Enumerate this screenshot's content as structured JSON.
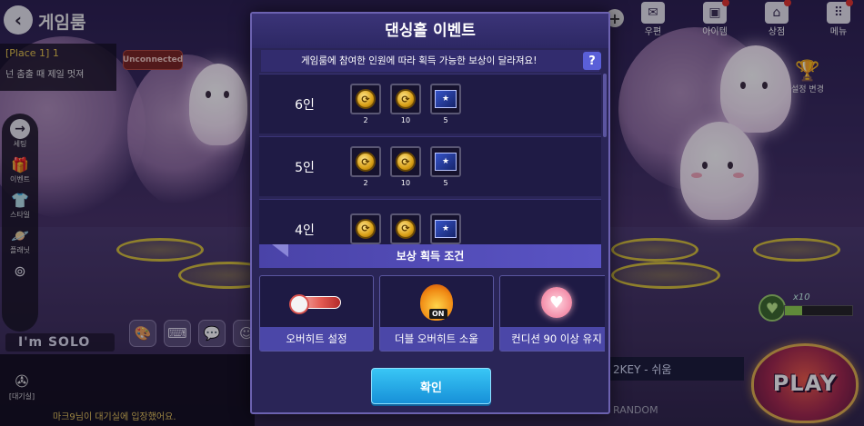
{
  "header": {
    "back_icon": "back-arrow-icon",
    "title": "게임룸",
    "top_icons": [
      {
        "name": "mail",
        "label": "우편",
        "glyph": "✉",
        "badge": false
      },
      {
        "name": "item",
        "label": "아이템",
        "glyph": "▣",
        "badge": true
      },
      {
        "name": "shop",
        "label": "상점",
        "glyph": "⌂",
        "badge": true
      },
      {
        "name": "menu",
        "label": "메뉴",
        "glyph": "⠿",
        "badge": true
      }
    ]
  },
  "place_box": {
    "place": "[Place 1] 1",
    "room_name": "넌 춤출 때 제일 멋져"
  },
  "status_badge": "Unconnected",
  "sidebar": {
    "items": [
      {
        "label": "세팅",
        "icon": "arrow-right-icon"
      },
      {
        "label": "이벤트",
        "icon": "gift-icon"
      },
      {
        "label": "스타일",
        "icon": "shirt-icon"
      },
      {
        "label": "플래닛",
        "icon": "planet-icon"
      },
      {
        "label": "",
        "icon": "binoculars-icon"
      }
    ]
  },
  "solo_tag": "I'm SOLO",
  "chat": {
    "wait_label": "[대기실]",
    "message": "마크9님이 대기실에 입장했어요."
  },
  "right_panel": {
    "settings_label": "설정 변경",
    "level_text": "x10",
    "xp_fraction": 0.25,
    "song_mode": "2KEY - 쉬움",
    "song_sub": "RANDOM",
    "play_label": "PLAY"
  },
  "modal": {
    "title": "댄싱홀 이벤트",
    "subtitle": "게임룸에 참여한 인원에 따라 획득 가능한 보상이 달라져요!",
    "help": "?",
    "rewards": [
      {
        "label": "6인",
        "items": [
          {
            "type": "coin",
            "qty": "2"
          },
          {
            "type": "coin",
            "qty": "10"
          },
          {
            "type": "ticket",
            "qty": "5"
          }
        ]
      },
      {
        "label": "5인",
        "items": [
          {
            "type": "coin",
            "qty": "2"
          },
          {
            "type": "coin",
            "qty": "10"
          },
          {
            "type": "ticket",
            "qty": "5"
          }
        ]
      },
      {
        "label": "4인",
        "items": [
          {
            "type": "coin",
            "qty": ""
          },
          {
            "type": "coin",
            "qty": ""
          },
          {
            "type": "ticket",
            "qty": ""
          }
        ]
      }
    ],
    "conditions_title": "보상 획득 조건",
    "conditions": [
      {
        "icon": "overheat-icon",
        "label": "오버히트 설정"
      },
      {
        "icon": "double-overheat-soul-icon",
        "label": "더블 오버히트 소울"
      },
      {
        "icon": "heart-condition-icon",
        "label": "컨디션 90 이상 유지"
      }
    ],
    "confirm_label": "확인"
  },
  "colors": {
    "accent": "#2aa7ea",
    "modal_bg": "#2a2557",
    "condition_header": "#5a54c4"
  }
}
